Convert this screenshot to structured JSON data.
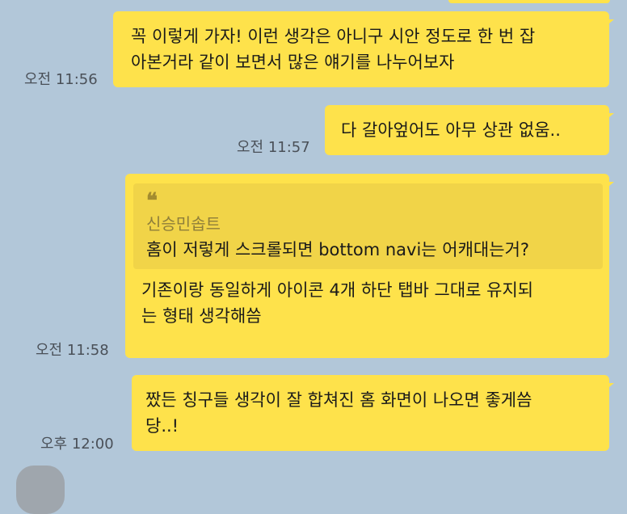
{
  "messages": [
    {
      "time": "오전 11:56",
      "text": "꼭 이렇게 가자! 이런 생각은 아니구 시안 정도로 한 번 잡\n아본거라 같이 보면서 많은 얘기를 나누어보자"
    },
    {
      "time": "오전 11:57",
      "text": "다 갈아엎어도 아무 상관 없움.."
    },
    {
      "time": "오전 11:58",
      "quote_mark": "❝",
      "quote_author": "신승민솝트",
      "quote_text": "홈이 저렇게 스크롤되면 bottom navi는 어캐대는거?",
      "text": "기존이랑 동일하게 아이콘 4개 하단 탭바 그대로 유지되\n는 형태 생각해씀"
    },
    {
      "time": "오후 12:00",
      "text": "짰든 칭구들 생각이 잘 합쳐진 홈 화면이 나오면 좋게씀\n당..!"
    }
  ],
  "colors": {
    "background": "#b2c7d9",
    "bubble": "#fee24b",
    "quote_background": "#f1d448",
    "timestamp": "#4a5058"
  }
}
